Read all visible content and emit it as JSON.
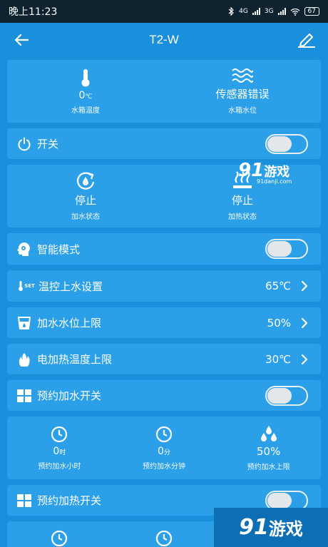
{
  "statusbar": {
    "time": "晚上11:23",
    "network_1": "4G",
    "network_2": "3G",
    "battery": "67"
  },
  "appbar": {
    "title": "T2-W"
  },
  "tank": {
    "temp_value": "0",
    "temp_unit": "℃",
    "temp_label": "水箱温度",
    "level_value": "传感器错误",
    "level_label": "水箱水位"
  },
  "power": {
    "label": "开关"
  },
  "status": {
    "fill_value": "停止",
    "fill_label": "加水状态",
    "heat_value": "停止",
    "heat_label": "加热状态"
  },
  "smart": {
    "label": "智能模式"
  },
  "temp_ctrl": {
    "icon_text": "SET",
    "label": "温控上水设置",
    "value": "65℃"
  },
  "level_limit": {
    "label": "加水水位上限",
    "value": "50%"
  },
  "heat_limit": {
    "label": "电加热温度上限",
    "value": "30℃"
  },
  "sched_fill": {
    "label": "预约加水开关"
  },
  "sched_fill_detail": {
    "hour_value": "0",
    "hour_unit": "时",
    "hour_label": "预约加水小时",
    "min_value": "0",
    "min_unit": "分",
    "min_label": "预约加水分钟",
    "limit_value": "50%",
    "limit_label": "预约加水上限"
  },
  "sched_heat": {
    "label": "预约加热开关"
  },
  "watermark": {
    "brand_num": "91",
    "brand_text": "游戏",
    "domain": "91danji.com"
  },
  "colors": {
    "background": "#1a8fdc",
    "card": "#2ba0e8",
    "statusbar": "#0f2230"
  }
}
